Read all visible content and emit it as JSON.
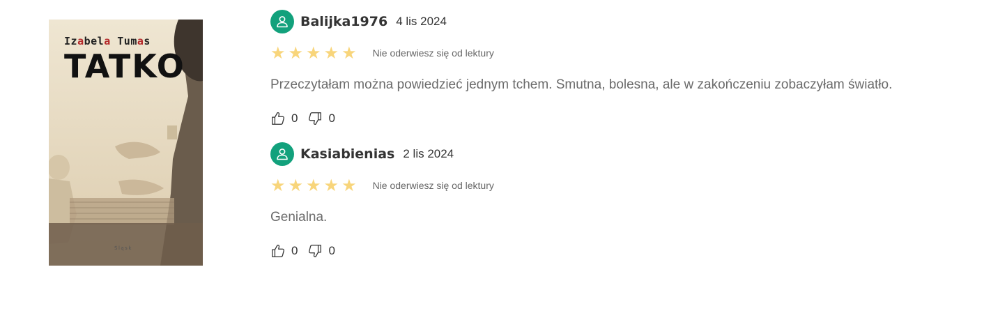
{
  "book": {
    "cover_author": "Izabela Tumas",
    "cover_title": "TATKO",
    "cover_publisher": "Śląsk"
  },
  "colors": {
    "avatar_green": "#12a17c",
    "star_yellow": "#f8d57b",
    "cover_accent_red": "#b4292a"
  },
  "icons": {
    "avatar": "user-icon",
    "like": "thumbs-up-icon",
    "dislike": "thumbs-down-icon",
    "star": "star-icon"
  },
  "reviews": [
    {
      "username": "Balijka1976",
      "date": "4 lis 2024",
      "rating": 5,
      "rating_max": 5,
      "rating_label": "Nie oderwiesz się od lektury",
      "text": "Przeczytałam można powiedzieć jednym tchem. Smutna, bolesna, ale w zakończeniu zobaczyłam światło.",
      "likes": "0",
      "dislikes": "0"
    },
    {
      "username": "Kasiabienias",
      "date": "2 lis 2024",
      "rating": 5,
      "rating_max": 5,
      "rating_label": "Nie oderwiesz się od lektury",
      "text": "Genialna.",
      "likes": "0",
      "dislikes": "0"
    }
  ]
}
